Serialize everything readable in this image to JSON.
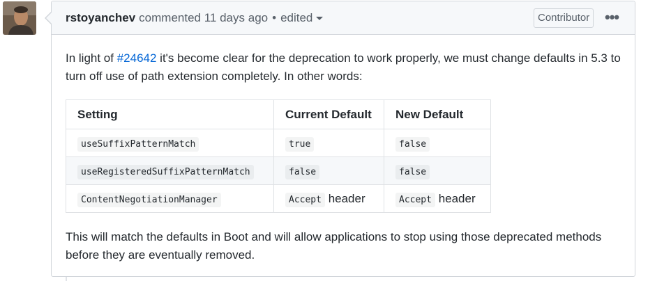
{
  "comment": {
    "author": "rstoyanchev",
    "action": "commented",
    "time": "11 days ago",
    "separator": "•",
    "edited_label": "edited",
    "badge": "Contributor",
    "menu_icon": "kebab-horizontal-icon",
    "avatar_icon": "user-avatar"
  },
  "body": {
    "p1_before": "In light of ",
    "p1_link": "#24642",
    "p1_after": " it's become clear for the deprecation to work properly, we must change defaults in 5.3 to turn off use of path extension completely. In other words:",
    "p2": "This will match the defaults in Boot and will allow applications to stop using those deprecated methods before they are eventually removed."
  },
  "table": {
    "headers": [
      "Setting",
      "Current Default",
      "New Default"
    ],
    "rows": [
      [
        {
          "code": "useSuffixPatternMatch",
          "text": ""
        },
        {
          "code": "true",
          "text": ""
        },
        {
          "code": "false",
          "text": ""
        }
      ],
      [
        {
          "code": "useRegisteredSuffixPatternMatch",
          "text": ""
        },
        {
          "code": "false",
          "text": ""
        },
        {
          "code": "false",
          "text": ""
        }
      ],
      [
        {
          "code": "ContentNegotiationManager",
          "text": ""
        },
        {
          "code": "Accept",
          "text": " header"
        },
        {
          "code": "Accept",
          "text": " header"
        }
      ]
    ]
  },
  "colors": {
    "link": "#0366d6",
    "header_bg": "#f6f8fa",
    "border": "#d1d5da"
  }
}
